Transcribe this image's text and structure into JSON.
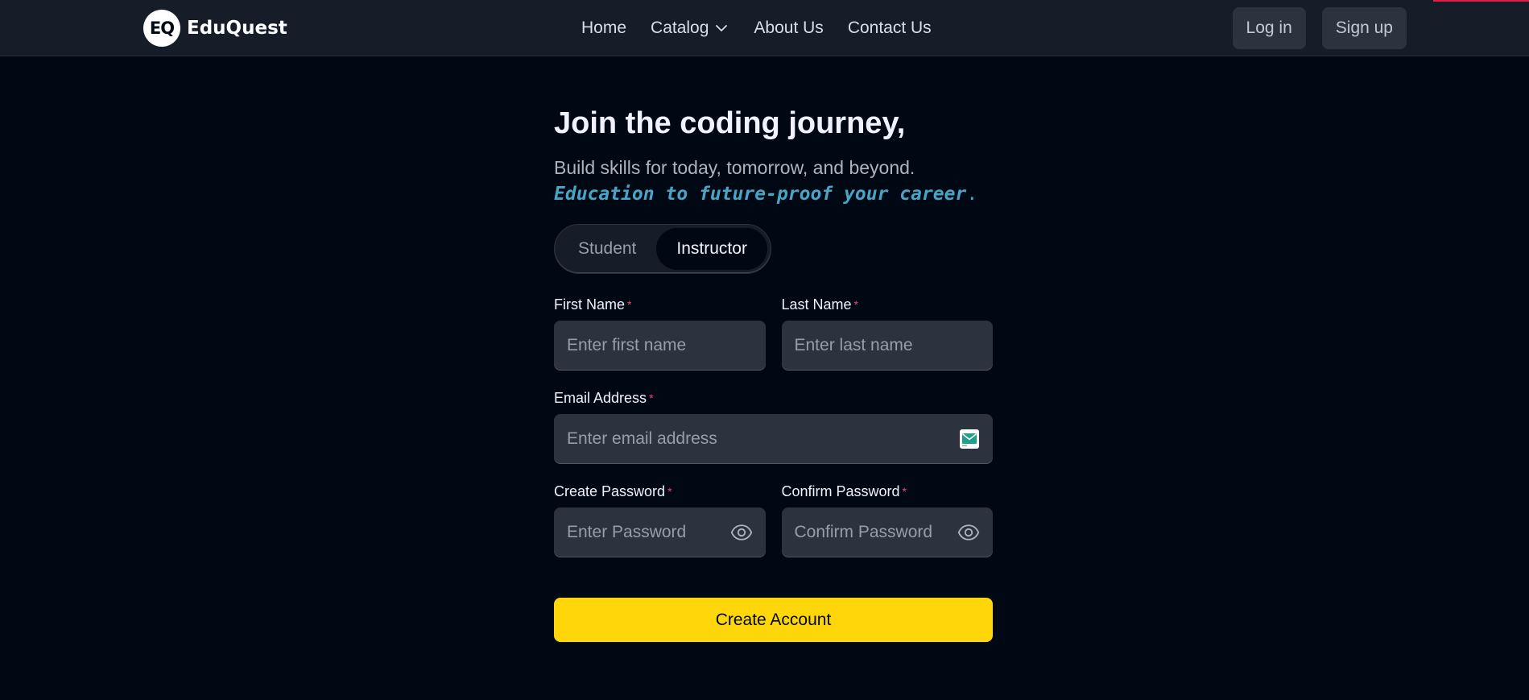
{
  "colors": {
    "page_bg": "#000814",
    "nav_bg": "#161d29",
    "input_bg": "#2c333f",
    "accent_yellow": "#ffd60a",
    "tagline_blue": "#47a5c5",
    "required_red": "#ef476f",
    "corner_accent": "#e11d48"
  },
  "nav": {
    "logo_badge": "EQ",
    "brand": "EduQuest",
    "links": [
      {
        "label": "Home"
      },
      {
        "label": "Catalog",
        "icon": "chevron-down-icon"
      },
      {
        "label": "About Us"
      },
      {
        "label": "Contact Us"
      }
    ],
    "login_label": "Log in",
    "signup_label": "Sign up"
  },
  "hero": {
    "title": "Join the coding journey,",
    "subtitle": "Build skills for today, tomorrow, and beyond.",
    "tagline": "Education to future-proof your career",
    "tagline_end": "."
  },
  "role_toggle": {
    "options": [
      "Student",
      "Instructor"
    ],
    "selected": "Instructor"
  },
  "form": {
    "required_mark": "*",
    "first_name": {
      "label": "First Name",
      "placeholder": "Enter first name",
      "value": ""
    },
    "last_name": {
      "label": "Last Name",
      "placeholder": "Enter last name",
      "value": ""
    },
    "email": {
      "label": "Email Address",
      "placeholder": "Enter email address",
      "value": "",
      "icon": "email-icon"
    },
    "password": {
      "label": "Create Password",
      "placeholder": "Enter Password",
      "value": "",
      "icon": "eye-icon"
    },
    "confirm_password": {
      "label": "Confirm Password",
      "placeholder": "Confirm Password",
      "value": "",
      "icon": "eye-icon"
    },
    "submit_label": "Create Account"
  }
}
